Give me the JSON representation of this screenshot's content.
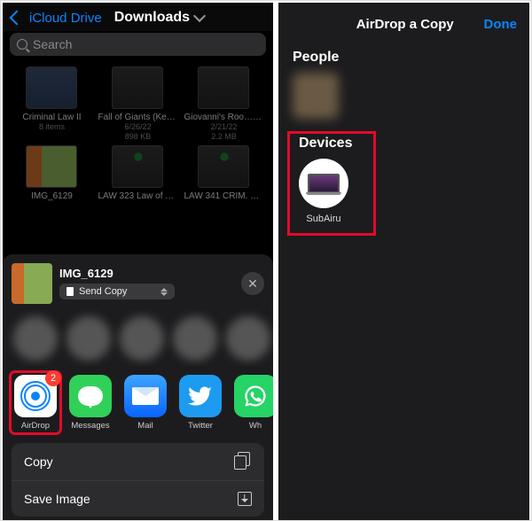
{
  "left": {
    "back_label": "iCloud Drive",
    "title": "Downloads",
    "search_placeholder": "Search",
    "files": [
      {
        "name": "Criminal Law II",
        "meta1": "8 items",
        "meta2": ""
      },
      {
        "name": "Fall of Giants (Ken….epub",
        "meta1": "6/26/22",
        "meta2": "898 KB"
      },
      {
        "name": "Giovanni's Roo….epub",
        "meta1": "2/21/22",
        "meta2": "2.2 MB"
      },
      {
        "name": "IMG_6129",
        "meta1": "",
        "meta2": ""
      },
      {
        "name": "LAW 323 Law of Torts I",
        "meta1": "",
        "meta2": ""
      },
      {
        "name": "LAW 341 CRIM. LAW I",
        "meta1": "",
        "meta2": ""
      }
    ],
    "sheet": {
      "item_name": "IMG_6129",
      "send_copy_label": "Send Copy",
      "airdrop_badge": "2",
      "apps": {
        "airdrop": "AirDrop",
        "messages": "Messages",
        "mail": "Mail",
        "twitter": "Twitter",
        "whatsapp": "Wh"
      },
      "actions": {
        "copy": "Copy",
        "save_image": "Save Image"
      }
    }
  },
  "right": {
    "title": "AirDrop a Copy",
    "done": "Done",
    "people_label": "People",
    "devices_label": "Devices",
    "device_name": "SubAiru"
  }
}
